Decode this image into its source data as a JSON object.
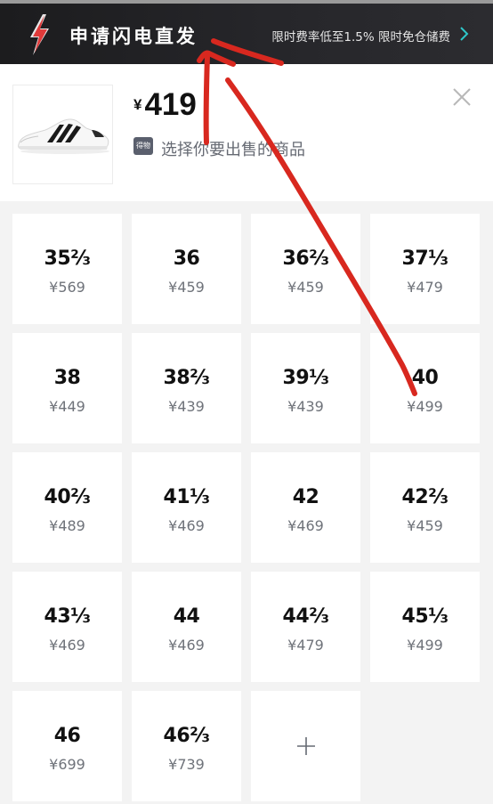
{
  "banner": {
    "title": "申请闪电直发",
    "note": "限时费率低至1.5% 限时免仓储费"
  },
  "product": {
    "currency": "¥",
    "price": "419",
    "brand_tag": "得物",
    "select_hint": "选择你要出售的商品"
  },
  "sizes": [
    {
      "size": "35⅔",
      "price": "¥569"
    },
    {
      "size": "36",
      "price": "¥459"
    },
    {
      "size": "36⅔",
      "price": "¥459"
    },
    {
      "size": "37⅓",
      "price": "¥479"
    },
    {
      "size": "38",
      "price": "¥449"
    },
    {
      "size": "38⅔",
      "price": "¥439"
    },
    {
      "size": "39⅓",
      "price": "¥439"
    },
    {
      "size": "40",
      "price": "¥499"
    },
    {
      "size": "40⅔",
      "price": "¥489"
    },
    {
      "size": "41⅓",
      "price": "¥469"
    },
    {
      "size": "42",
      "price": "¥469"
    },
    {
      "size": "42⅔",
      "price": "¥459"
    },
    {
      "size": "43⅓",
      "price": "¥469"
    },
    {
      "size": "44",
      "price": "¥469"
    },
    {
      "size": "44⅔",
      "price": "¥479"
    },
    {
      "size": "45⅓",
      "price": "¥499"
    },
    {
      "size": "46",
      "price": "¥699"
    },
    {
      "size": "46⅔",
      "price": "¥739"
    }
  ],
  "add_cell": {
    "icon": "plus-icon"
  },
  "colors": {
    "banner_bg": "#1c1c1e",
    "bolt_red": "#e03a3a",
    "chevron_teal": "#2ec7c9",
    "annotation_red": "#d8281f",
    "grid_bg": "#f3f3f3",
    "cell_bg": "#ffffff"
  }
}
